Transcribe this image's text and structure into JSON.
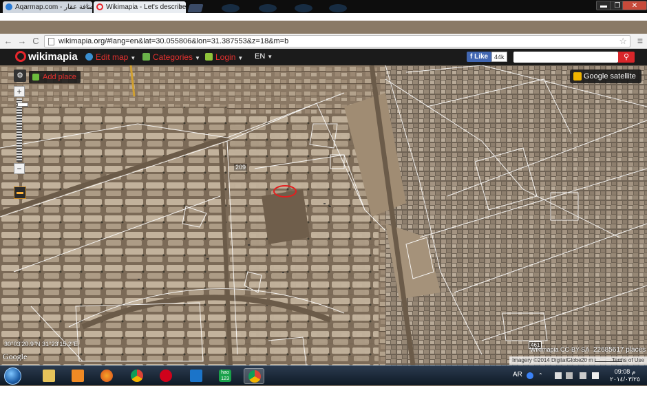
{
  "browser": {
    "tabs": [
      {
        "title": "Aqarmap.com - إضافة عقار",
        "close": "×"
      },
      {
        "title": "Wikimapia - Let's describe",
        "close": "×"
      }
    ],
    "url": "wikimapia.org/#lang=en&lat=30.055806&lon=31.387553&z=18&m=b",
    "window_buttons": {
      "minimize": "▬",
      "maximize": "❐",
      "close": "✕"
    },
    "nav": {
      "back": "←",
      "forward": "→",
      "reload": "C"
    }
  },
  "wikimapia": {
    "logo": "wikimapia",
    "menu": [
      {
        "label": "Edit map",
        "icon": "globe-icon",
        "color": "#3a8fd1"
      },
      {
        "label": "Categories",
        "icon": "categories-icon",
        "color": "#6bb24a"
      },
      {
        "label": "Login",
        "icon": "login-icon",
        "color": "#8fc43a"
      }
    ],
    "language": "EN",
    "fb_like": "Like",
    "fb_count": "44k",
    "search_placeholder": ""
  },
  "map": {
    "add_place": "Add place",
    "google_satellite": "Google satellite",
    "coords": "30°03'20.9\"N 31°23'15.2\"E",
    "google_logo": "Google",
    "license": "Wikimapia CC-BY-SA",
    "places_count": "22685617 places",
    "imagery": "Imagery ©2014 DigitalGlobe",
    "scale": "20 m",
    "terms": "Terms of Use",
    "labels": {
      "a": "209",
      "b": "461"
    }
  },
  "taskbar": {
    "apps": [
      "explorer",
      "media-player",
      "firefox",
      "chrome",
      "opera",
      "vector-app",
      "hao123",
      "chrome-active"
    ],
    "hao": "hao 123",
    "tray_lang": "AR",
    "time_period": "م",
    "time": "09:08",
    "date": "٢٠١٤/٠٣/٢٥"
  }
}
